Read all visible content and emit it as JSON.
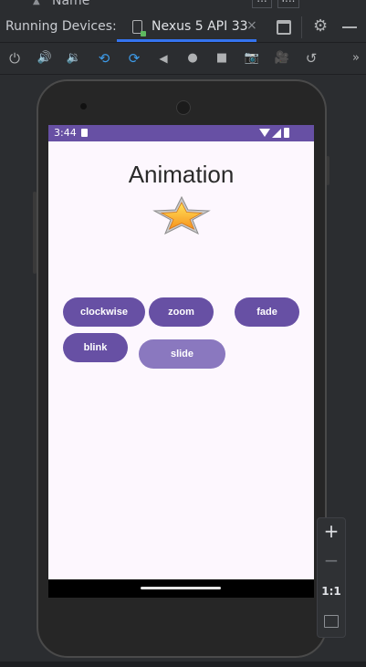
{
  "top_strip": {
    "column_name": "Name",
    "box1": "...",
    "box2": "I..."
  },
  "window": {
    "panel_title": "Running Devices:",
    "device_tab": "Nexus 5 API 33",
    "tab_close": "×"
  },
  "toolbar": {
    "buttons": [
      {
        "icon": "power-icon",
        "glyph": "⏻"
      },
      {
        "icon": "volume-up-icon",
        "glyph": "🔊"
      },
      {
        "icon": "volume-down-icon",
        "glyph": "🔉"
      },
      {
        "icon": "rotate-left-icon",
        "glyph": "⟲"
      },
      {
        "icon": "rotate-right-icon",
        "glyph": "⟳"
      },
      {
        "icon": "back-icon",
        "glyph": "◀"
      },
      {
        "icon": "home-icon",
        "glyph": "●"
      },
      {
        "icon": "overview-icon",
        "glyph": "■"
      },
      {
        "icon": "screenshot-icon",
        "glyph": "📷"
      },
      {
        "icon": "screen-record-icon",
        "glyph": "🎥"
      },
      {
        "icon": "snapshot-icon",
        "glyph": "↺"
      }
    ],
    "overflow": "»"
  },
  "device": {
    "status_time": "3:44",
    "app_title": "Animation",
    "buttons": {
      "clockwise": "clockwise",
      "zoom": "zoom",
      "fade": "fade",
      "blink": "blink",
      "slide": "slide"
    }
  },
  "zoom_controls": {
    "plus": "+",
    "minus": "−",
    "one_to_one": "1:1"
  },
  "colors": {
    "accent": "#6750a4",
    "ide_bg": "#2b2d30",
    "tab_underline": "#3574f0"
  }
}
